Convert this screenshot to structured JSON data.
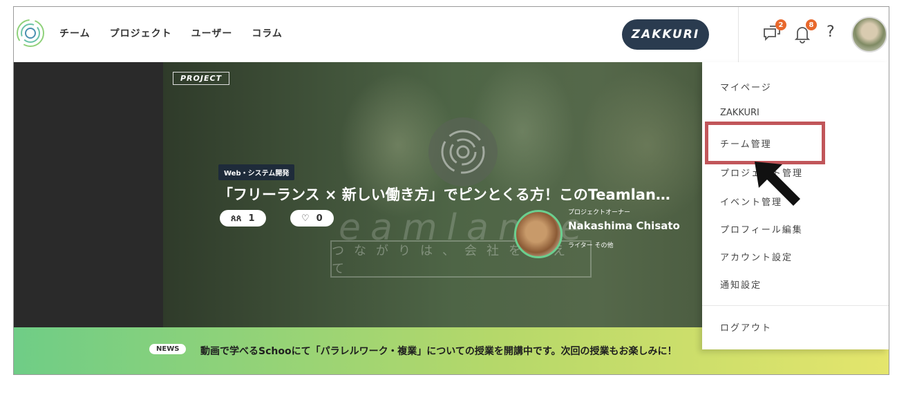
{
  "nav": {
    "items": [
      "チーム",
      "プロジェクト",
      "ユーザー",
      "コラム"
    ]
  },
  "header": {
    "zakkuri_label": "ZAKKURI",
    "message_badge": "2",
    "notification_badge": "8",
    "help_label": "?"
  },
  "hero": {
    "tag": "PROJECT",
    "category": "Web・システム開発",
    "title": "「フリーランス × 新しい働き方」でピンとくる方！このTeamlan…",
    "members_count": "1",
    "likes_count": "0",
    "watermark": "eamlance",
    "tagline": "つながりは、会社を超えて",
    "owner_caption": "プロジェクトオーナー",
    "owner_name": "Nakashima Chisato",
    "owner_role": "ライター その他"
  },
  "news": {
    "badge": "NEWS",
    "text": "動画で学べるSchooにて「パラレルワーク・複業」についての授業を開講中です。次回の授業もお楽しみに！"
  },
  "menu": {
    "items": [
      "マイページ",
      "ZAKKURI",
      "チーム管理",
      "プロジェクト管理",
      "イベント管理",
      "プロフィール編集",
      "アカウント設定",
      "通知設定"
    ],
    "logout": "ログアウト"
  },
  "colors": {
    "accent_dark": "#2a3b4f",
    "badge": "#e8682c",
    "highlight": "#c1565a",
    "news_start": "#6fcd86",
    "news_end": "#e4e56c"
  }
}
